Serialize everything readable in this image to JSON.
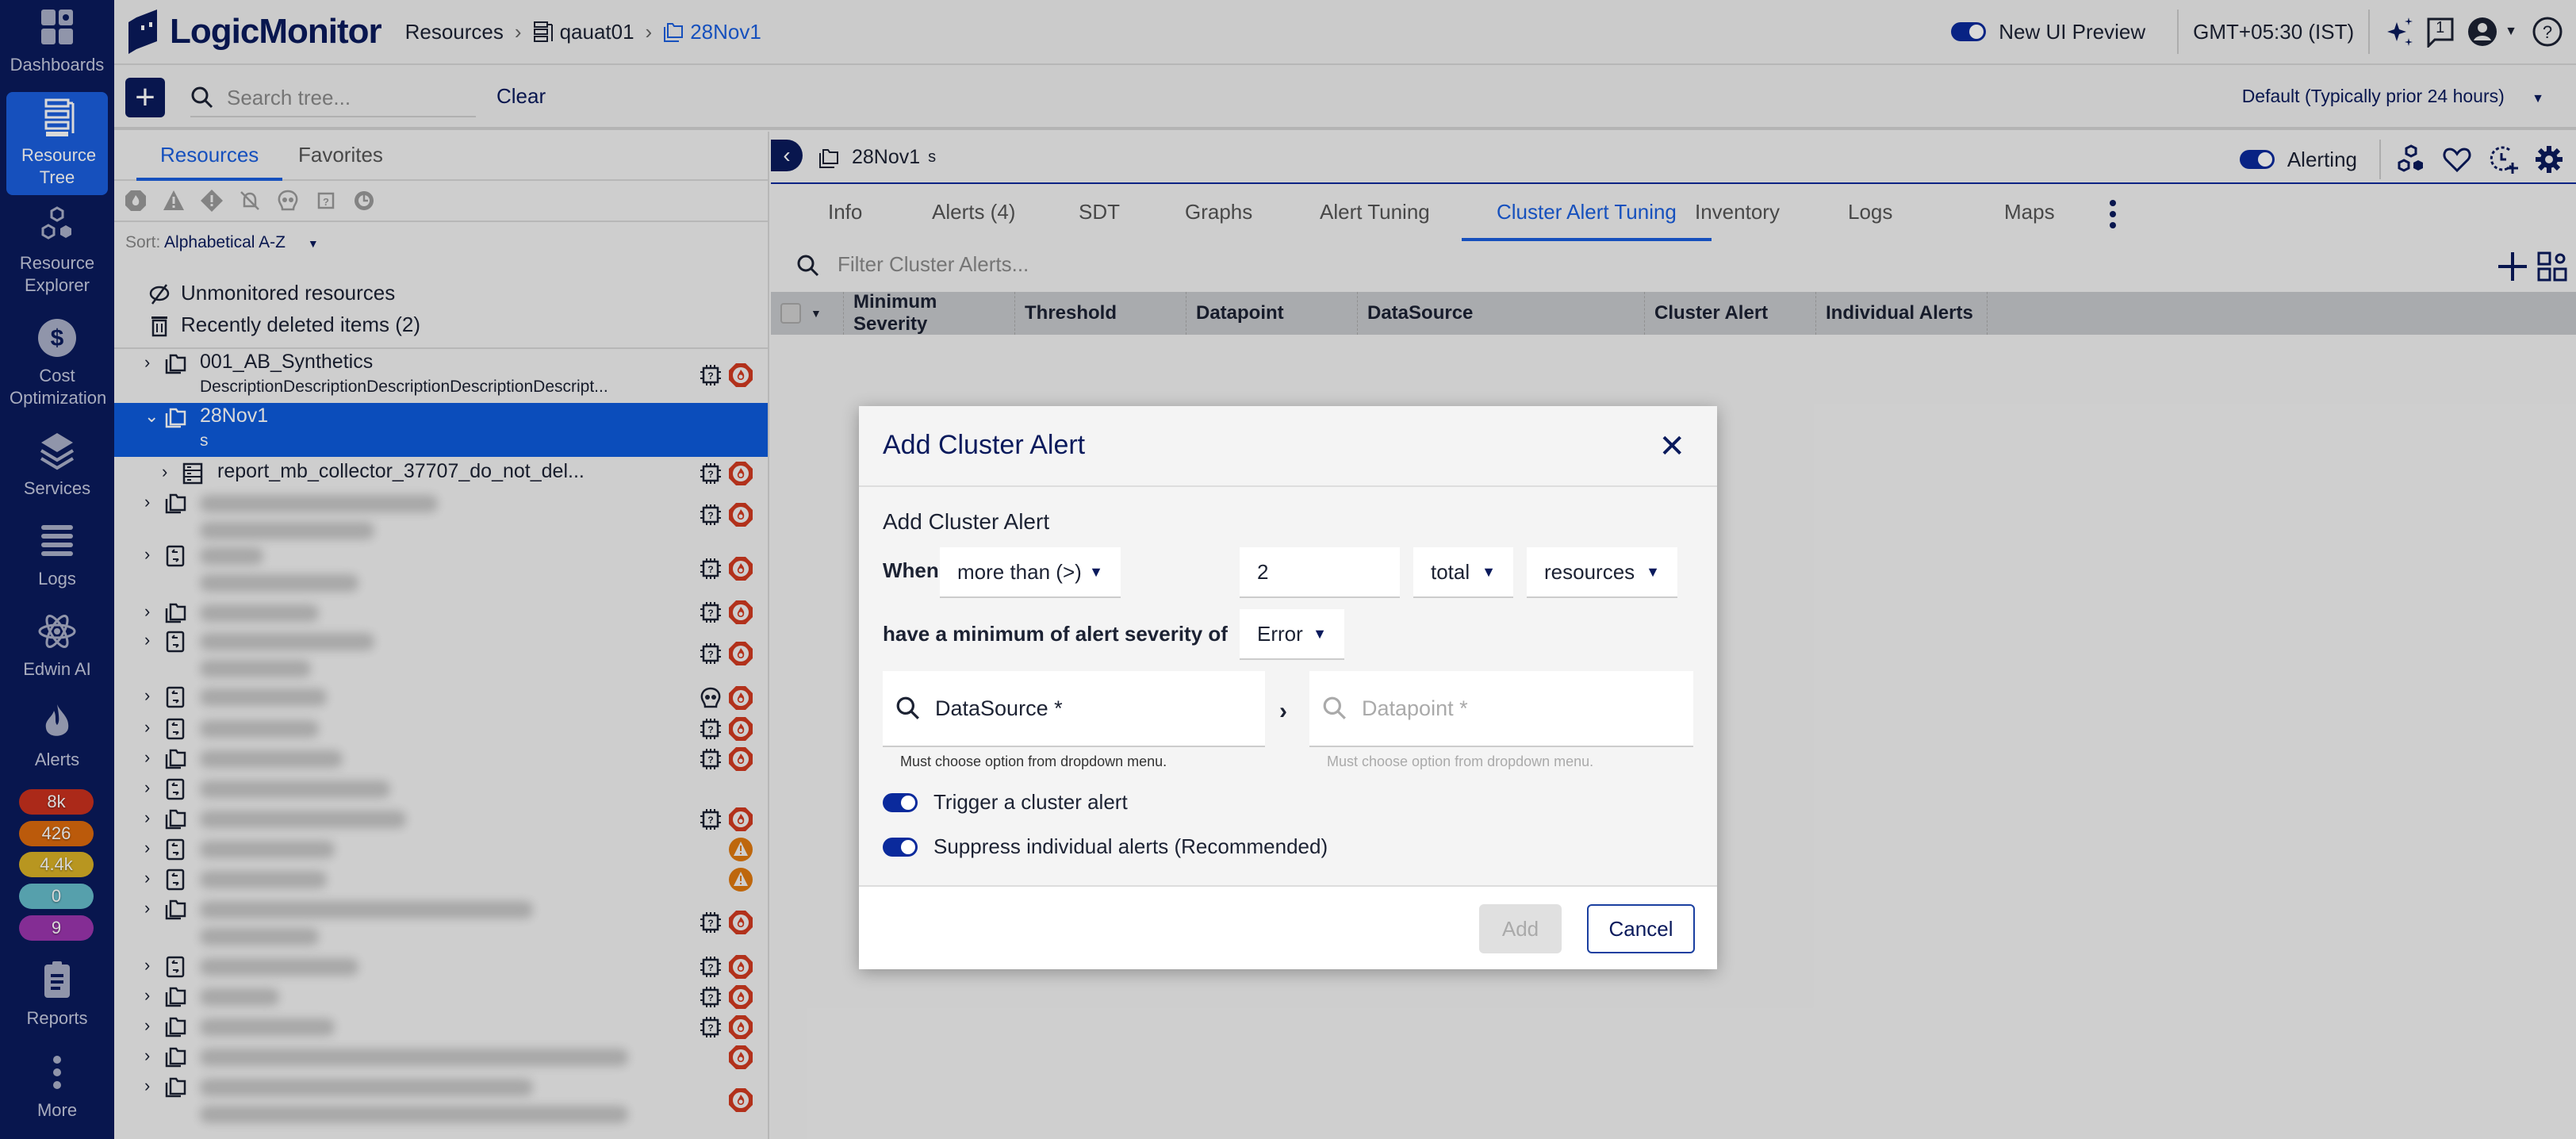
{
  "nav": {
    "items": [
      {
        "label": "Dashboards",
        "icon": "dashboard-icon"
      },
      {
        "label": "Resource Tree",
        "icon": "resource-tree-icon",
        "active": true
      },
      {
        "label": "Resource Explorer",
        "icon": "hexagons-icon"
      },
      {
        "label": "Cost Optimization",
        "icon": "dollar-icon"
      },
      {
        "label": "Services",
        "icon": "layers-icon"
      },
      {
        "label": "Logs",
        "icon": "logs-icon"
      },
      {
        "label": "Edwin AI",
        "icon": "atom-icon"
      },
      {
        "label": "Alerts",
        "icon": "flame-icon"
      },
      {
        "label": "Reports",
        "icon": "clipboard-icon"
      },
      {
        "label": "More",
        "icon": "more-vertical-icon"
      }
    ],
    "alert_badges": [
      {
        "value": "8k",
        "color": "#c9311e"
      },
      {
        "value": "426",
        "color": "#dc6a0d"
      },
      {
        "value": "4.4k",
        "color": "#d9b126"
      },
      {
        "value": "0",
        "color": "#66bccb"
      },
      {
        "value": "9",
        "color": "#9c36ae"
      }
    ]
  },
  "topbar": {
    "brand": "LogicMonitor",
    "breadcrumb": [
      "Resources",
      "qauat01",
      "28Nov1"
    ],
    "new_ui_label": "New UI Preview",
    "new_ui_enabled": true,
    "timezone": "GMT+05:30 (IST)",
    "notification_count": "1"
  },
  "toolbar": {
    "search_placeholder": "Search tree...",
    "clear_label": "Clear",
    "time_range": "Default (Typically prior 24 hours)"
  },
  "left_panel": {
    "tabs": [
      "Resources",
      "Favorites"
    ],
    "active_tab": "Resources",
    "filter_icons": [
      "critical-filter-icon",
      "warning-filter-icon",
      "error-filter-icon",
      "alerts-disabled-filter-icon",
      "dead-filter-icon",
      "unknown-collector-filter-icon",
      "sdt-filter-icon"
    ],
    "sort_label": "Sort:",
    "sort_value": "Alphabetical A-Z",
    "unmonitored_label": "Unmonitored resources",
    "deleted_label": "Recently deleted items (2)",
    "tree": [
      {
        "name": "001_AB_Synthetics",
        "desc": "DescriptionDescriptionDescriptionDescriptionDescript...",
        "type": "group"
      },
      {
        "name": "28Nov1",
        "desc": "s",
        "type": "group",
        "selected": true,
        "expanded": true
      },
      {
        "name": "report_mb_collector_37707_do_not_del...",
        "type": "collector",
        "child": true
      }
    ]
  },
  "content": {
    "title": "28Nov1",
    "subtitle": "s",
    "alerting_label": "Alerting",
    "alerting_enabled": true,
    "tabs": [
      "Info",
      "Alerts (4)",
      "SDT",
      "Graphs",
      "Alert Tuning",
      "Cluster Alert Tuning",
      "Inventory",
      "Logs",
      "Maps"
    ],
    "active_tab": "Cluster Alert Tuning",
    "filter_placeholder": "Filter Cluster Alerts...",
    "columns": [
      "Minimum Severity",
      "Threshold",
      "Datapoint",
      "DataSource",
      "Cluster Alert",
      "Individual Alerts"
    ]
  },
  "modal": {
    "title": "Add Cluster Alert",
    "section_title": "Add Cluster Alert",
    "when_label": "When",
    "comparison": "more than (>)",
    "count_value": "2",
    "count_type": "total",
    "target": "resources",
    "severity_label": "have a minimum of alert severity of",
    "severity": "Error",
    "datasource_placeholder": "DataSource *",
    "datapoint_placeholder": "Datapoint *",
    "hint": "Must choose option from dropdown menu.",
    "trigger_label": "Trigger a cluster alert",
    "trigger_enabled": true,
    "suppress_label": "Suppress individual alerts (Recommended)",
    "suppress_enabled": true,
    "add_label": "Add",
    "cancel_label": "Cancel"
  }
}
